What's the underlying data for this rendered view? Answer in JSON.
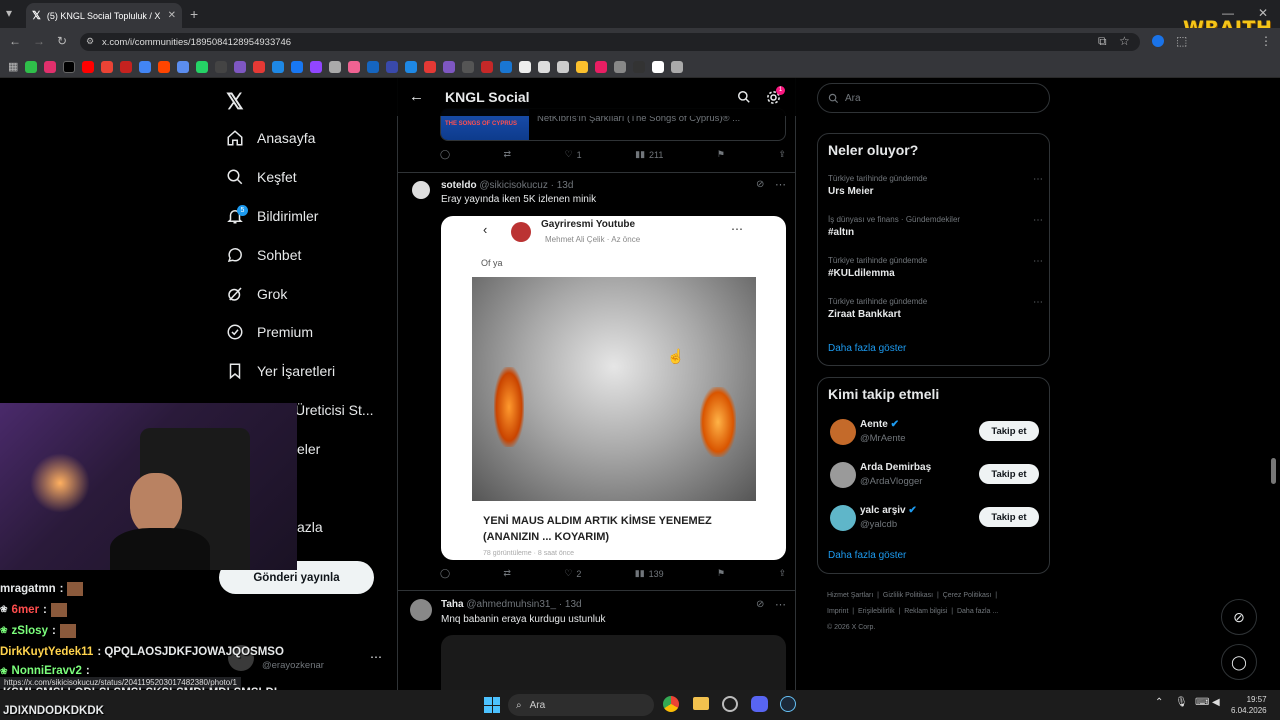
{
  "browser": {
    "tab_title": "(5) KNGL Social Topluluk / X",
    "url": "x.com/i/communities/1895084128954933746",
    "overlay_brand": "WRAITH",
    "colors": {
      "accent": "#1d9bf0",
      "brand_yellow": "#f5c518"
    }
  },
  "nav": {
    "items": [
      {
        "label": "Anasayfa",
        "icon": "home-icon"
      },
      {
        "label": "Keşfet",
        "icon": "search-icon"
      },
      {
        "label": "Bildirimler",
        "icon": "bell-icon",
        "badge": "5"
      },
      {
        "label": "Sohbet",
        "icon": "chat-icon"
      },
      {
        "label": "Grok",
        "icon": "grok-icon"
      },
      {
        "label": "Premium",
        "icon": "premium-icon"
      },
      {
        "label": "Yer İşaretleri",
        "icon": "bookmark-icon"
      },
      {
        "label": "Üreticisi St...",
        "icon": "creator-icon"
      },
      {
        "label": "eler",
        "icon": "communities-icon"
      },
      {
        "label": "azla",
        "icon": "more-icon"
      }
    ],
    "post_button": "Gönderi yayınla",
    "account_handle": "@erayozkenar"
  },
  "header": {
    "title": "KNGL Social",
    "notif_badge": "1"
  },
  "feed": {
    "prev_post": {
      "card_text": "NetKıbrıs'ın Şarkıları (The Songs of Cyprus)® ...",
      "card_thumb_text": "THE SONGS OF CYPRUS",
      "likes": "1",
      "views": "211"
    },
    "post1": {
      "name": "soteldo",
      "handle": "@sikicisokucuz",
      "time": "· 13d",
      "text": "Eray yayında iken 5K izlenen minik",
      "embed": {
        "channel": "Gayriresmi Youtube",
        "meta": "Mehmet Ali Çelik · Az önce",
        "comment": "Of ya",
        "title": "YENİ MAUS ALDIM ARTIK KİMSE YENEMEZ (ANANIZIN ... KOYARIM)",
        "footer": "78 görüntüleme · 8 saat önce"
      },
      "likes": "2",
      "views": "139"
    },
    "post2": {
      "name": "Taha",
      "handle": "@ahmedmuhsin31_",
      "time": "· 13d",
      "text": "Mnq babanin eraya kurdugu ustunluk"
    }
  },
  "right": {
    "search_placeholder": "Ara",
    "trends_title": "Neler oluyor?",
    "trends": [
      {
        "context": "Türkiye tarihinde gündemde",
        "name": "Urs Meier"
      },
      {
        "context": "İş dünyası ve finans · Gündemdekiler",
        "name": "#altın"
      },
      {
        "context": "Türkiye tarihinde gündemde",
        "name": "#KULdilemma"
      },
      {
        "context": "Türkiye tarihinde gündemde",
        "name": "Ziraat Bankkart"
      }
    ],
    "show_more": "Daha fazla göster",
    "who_title": "Kimi takip etmeli",
    "who": [
      {
        "name": "Aente",
        "handle": "@MrAente",
        "verified": true,
        "button": "Takip et"
      },
      {
        "name": "Arda Demirbaş",
        "handle": "@ArdaVlogger",
        "verified": false,
        "button": "Takip et"
      },
      {
        "name": "yalc arşiv",
        "handle": "@yalcdb",
        "verified": true,
        "button": "Takip et"
      }
    ],
    "who_more": "Daha fazla göster",
    "footer_links": [
      "Hizmet Şartları",
      "Gizlilik Politikası",
      "Çerez Politikası",
      "Imprint",
      "Erişilebilirlik",
      "Reklam bilgisi",
      "Daha fazla ..."
    ],
    "copyright": "© 2026 X Corp."
  },
  "chat": {
    "lines": [
      {
        "user": "mragatmn",
        "color": "#ffffff",
        "text": ":"
      },
      {
        "user": "6mer",
        "color": "#ff4d4d",
        "text": ":"
      },
      {
        "user": "zSlosy",
        "color": "#7cff7c",
        "text": ":"
      },
      {
        "user": "DirkKuytYedek11",
        "color": "#ffd34d",
        "text": ": QPQLAOSJDKFJOWAJQOSMSO"
      },
      {
        "user": "NonniEravv2",
        "color": "#7cff7c",
        "text": ":"
      }
    ],
    "spam1": "KSMLSMSLLODLSLSMSLSKSLSMDLMDLSMSLDL",
    "spam2": "JDIXNDODKDKDK"
  },
  "status_url": "https://x.com/sikicisokucuz/status/2041195203017482380/photo/1",
  "taskbar": {
    "search": "Ara",
    "time": "19:57",
    "date": "6.04.2026"
  }
}
